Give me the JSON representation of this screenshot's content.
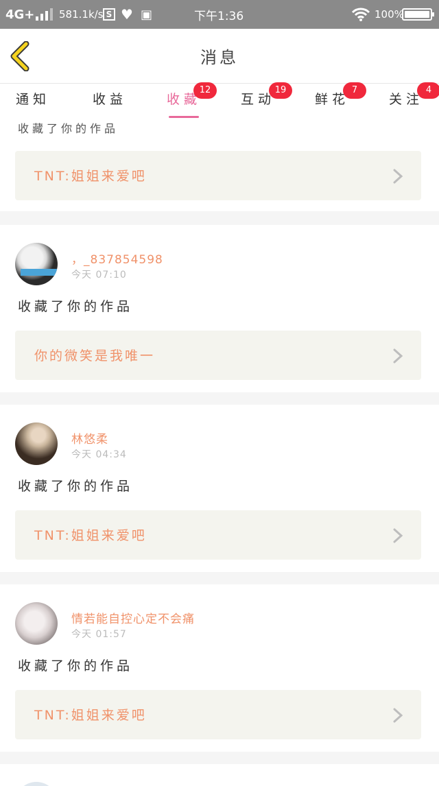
{
  "status_bar": {
    "network": "4G+",
    "speed": "581.1k/s",
    "sim_badge": "S",
    "time": "下午1:36",
    "battery": "100%",
    "icons": [
      "signal-icon",
      "heart-shield-icon",
      "clipboard-icon",
      "wifi-icon",
      "battery-icon"
    ]
  },
  "header": {
    "title": "消息",
    "back_icon": "chevron-left-icon",
    "back_color": "#f5d31e"
  },
  "tabs": [
    {
      "label": "通知",
      "badge": ""
    },
    {
      "label": "收益",
      "badge": ""
    },
    {
      "label": "收藏",
      "badge": "12",
      "active": true
    },
    {
      "label": "互动",
      "badge": "19"
    },
    {
      "label": "鲜花",
      "badge": "7"
    },
    {
      "label": "关注",
      "badge": "4"
    }
  ],
  "colors": {
    "accent_pink": "#e8699a",
    "name_orange": "#f0926a",
    "badge_red": "#f0283c",
    "work_box_bg": "#f4f4ee"
  },
  "items": [
    {
      "action": "收藏了你的作品",
      "work_title": "TNT:姐姐来爱吧"
    },
    {
      "username": "，_837854598",
      "time": "今天 07:10",
      "action": "收藏了你的作品",
      "work_title": "你的微笑是我唯一"
    },
    {
      "username": "林悠柔",
      "time": "今天 04:34",
      "action": "收藏了你的作品",
      "work_title": "TNT:姐姐来爱吧"
    },
    {
      "username": "情若能自控心定不会痛",
      "time": "今天 01:57",
      "action": "收藏了你的作品",
      "work_title": "TNT:姐姐来爱吧"
    }
  ]
}
